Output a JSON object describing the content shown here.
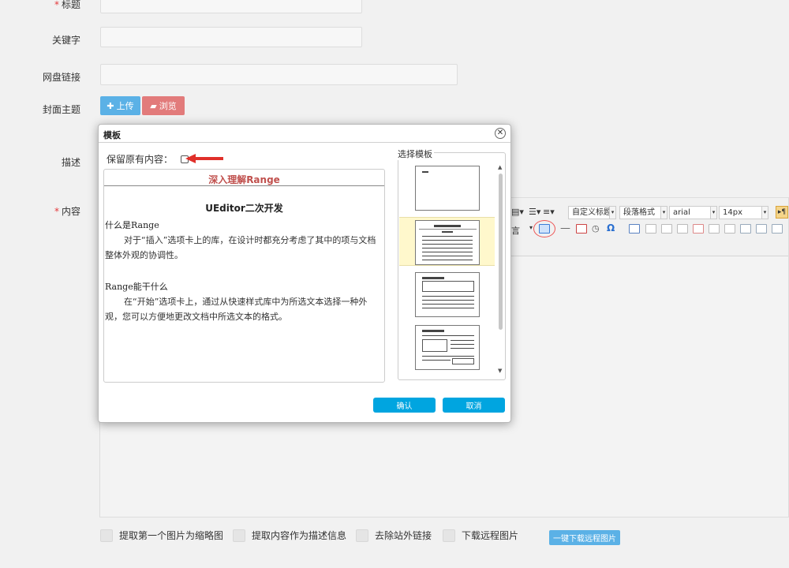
{
  "form": {
    "title_label": "标题",
    "keywords_label": "关键字",
    "netdisk_label": "网盘链接",
    "cover_label": "封面主题",
    "upload_button": "上传",
    "browse_button": "浏览",
    "desc_label": "描述",
    "content_label": "内容",
    "required_mark": "*"
  },
  "editor_toolbar": {
    "custom_title": "自定义标题",
    "paragraph_format": "段落格式",
    "font_family": "arial",
    "font_size": "14px",
    "partial_text": "言"
  },
  "bottom_options": [
    {
      "label": "提取第一个图片为缩略图",
      "checked": false
    },
    {
      "label": "提取内容作为描述信息",
      "checked": false
    },
    {
      "label": "去除站外链接",
      "checked": false
    },
    {
      "label": "下载远程图片",
      "checked": false
    }
  ],
  "remote_download_button": "一键下载远程图片",
  "modal": {
    "title": "模板",
    "close_icon": "close-circle-icon",
    "keep_content_label": "保留原有内容：",
    "keep_content_checked": false,
    "select_template_label": "选择模板",
    "preview": {
      "title": "深入理解Range",
      "heading": "UEditor二次开发",
      "section1_title": "什么是Range",
      "section1_text": "对于“插入”选项卡上的库，在设计时都充分考虑了其中的项与文档整体外观的协调性。",
      "section2_title": "Range能干什么",
      "section2_text": "在“开始”选项卡上，通过从快速样式库中为所选文本选择一种外观，您可以方便地更改文档中所选文本的格式。"
    },
    "selected_template_index": 1,
    "confirm_button": "确认",
    "cancel_button": "取消"
  },
  "colors": {
    "accent_blue": "#00a5e0",
    "upload_blue": "#5bb1e6",
    "browse_red": "#e27b7b",
    "preview_title_red": "#c0504d",
    "selected_template_bg": "#fff8cc"
  }
}
